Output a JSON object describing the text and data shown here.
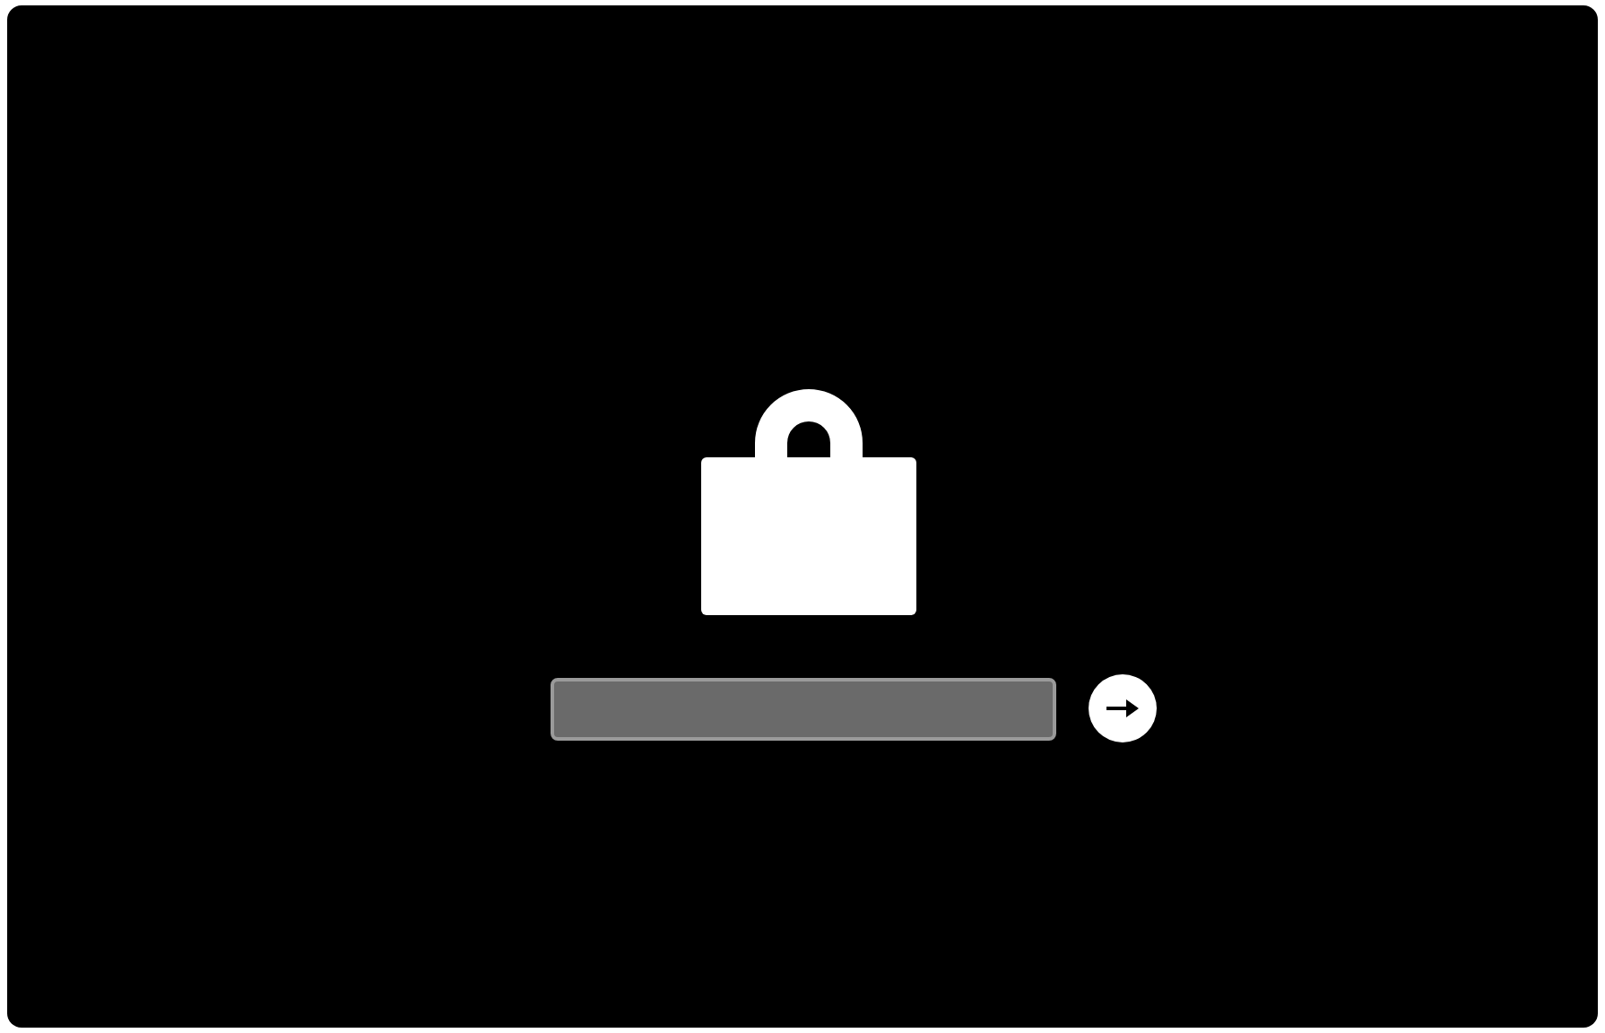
{
  "lock_screen": {
    "locked": true
  }
}
